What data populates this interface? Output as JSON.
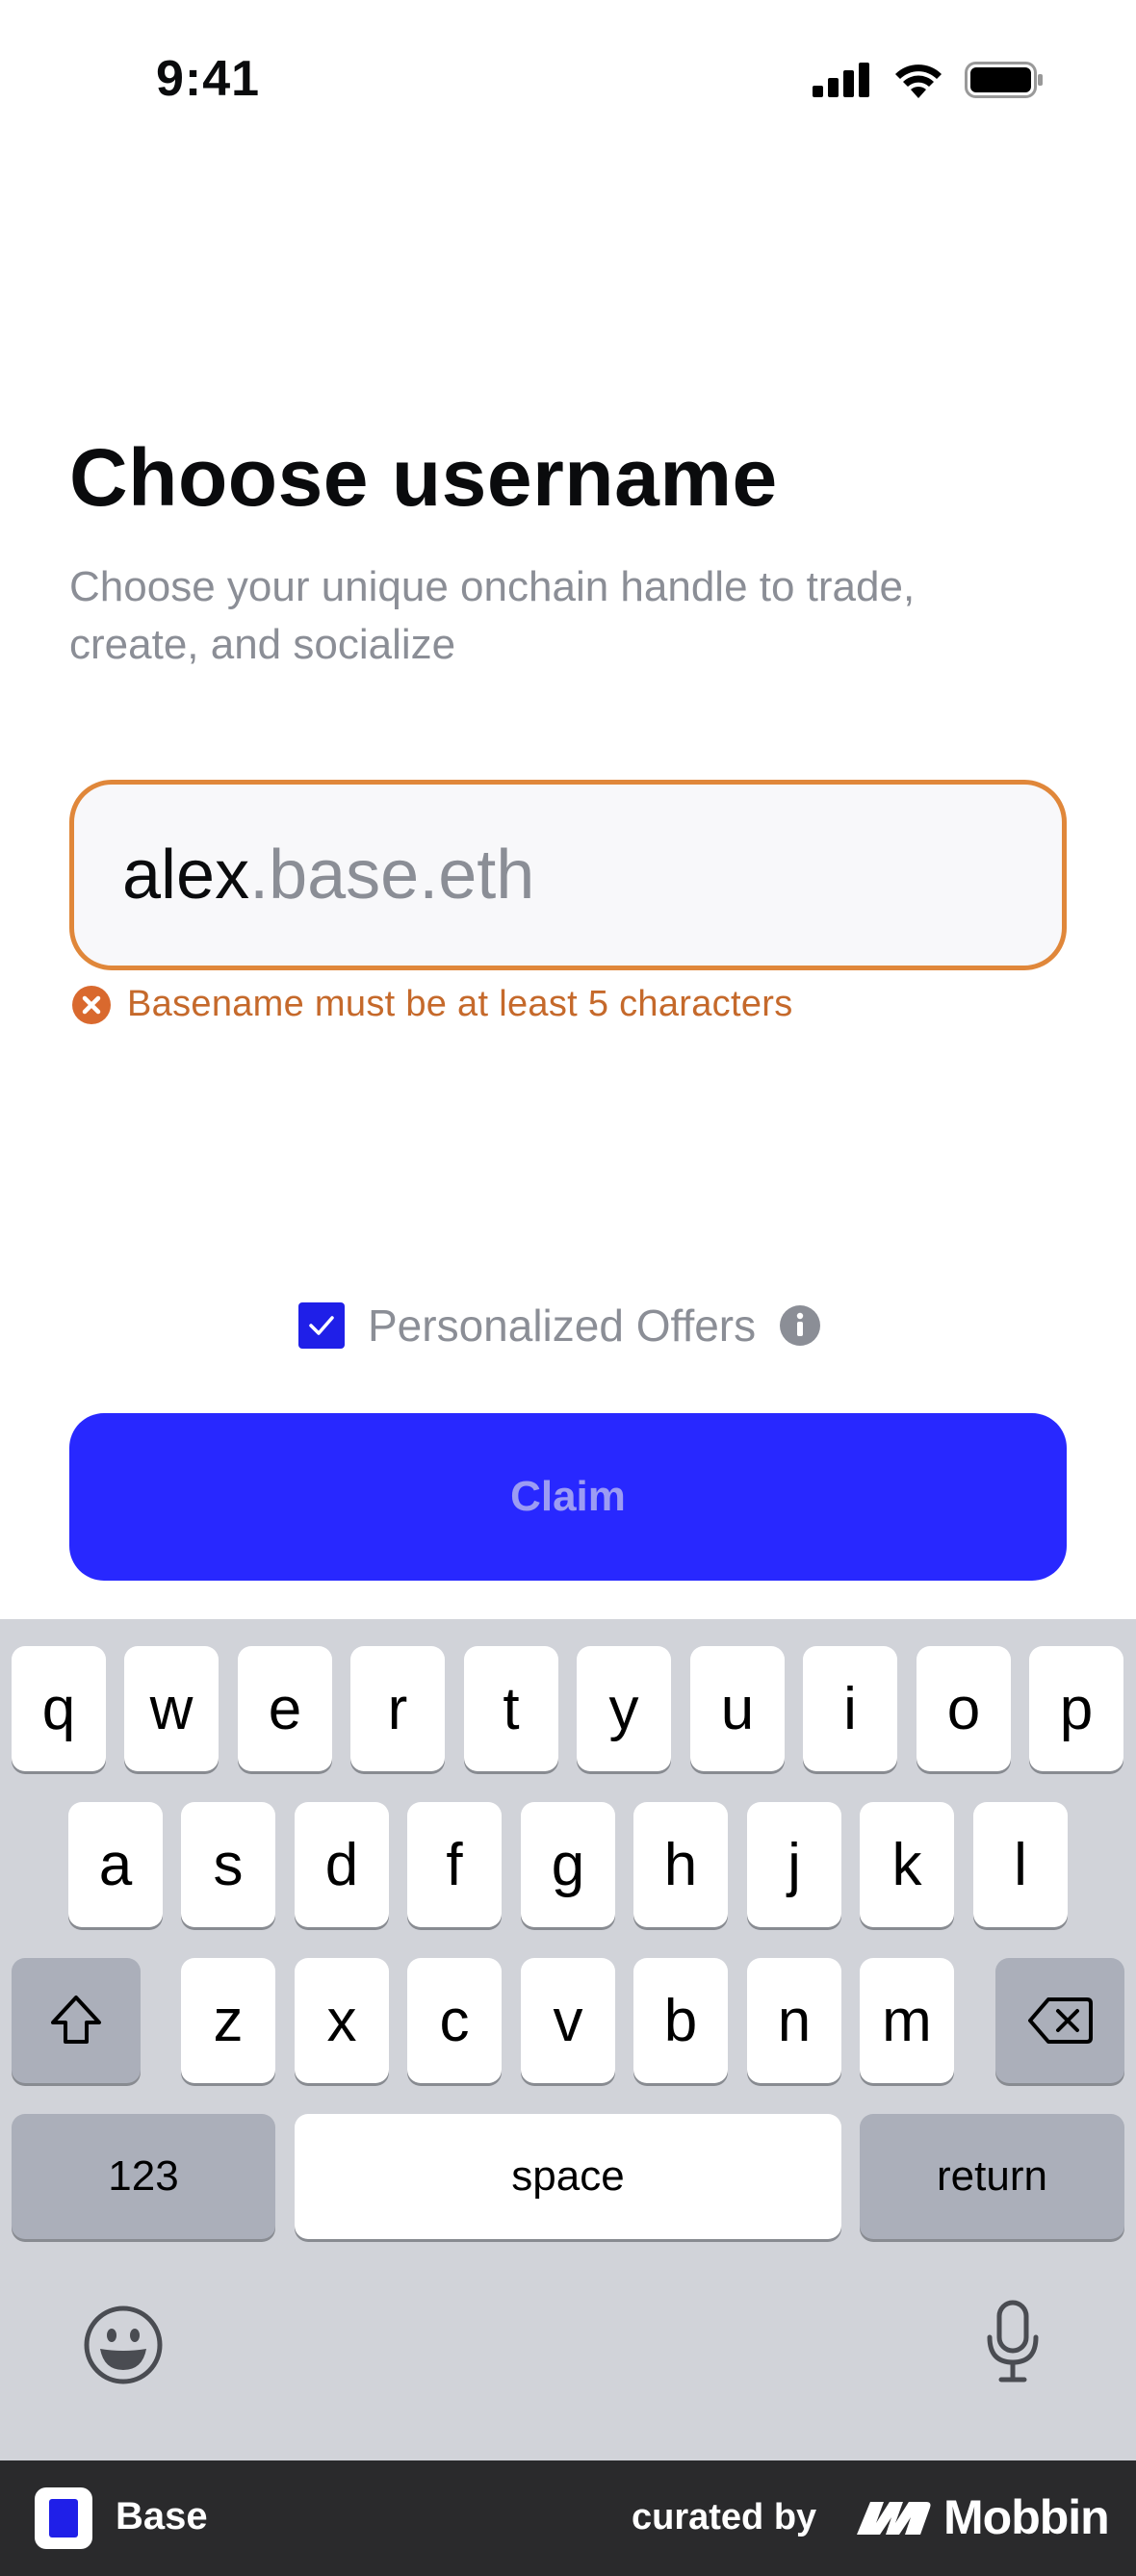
{
  "status_bar": {
    "time": "9:41",
    "icons": [
      "cellular-signal-icon",
      "wifi-icon",
      "battery-icon"
    ]
  },
  "header": {
    "title": "Choose username",
    "subtitle": "Choose your unique onchain handle to trade, create, and socialize"
  },
  "username_field": {
    "value": "alex",
    "suffix": ".base.eth",
    "border_color": "#e0873a"
  },
  "error": {
    "icon": "error-x-icon",
    "message": "Basename must be at least 5 characters",
    "color": "#c5692b"
  },
  "offers": {
    "checked": true,
    "label": "Personalized Offers",
    "info_icon": "info-icon"
  },
  "claim_button": {
    "label": "Claim",
    "color": "#2828ff"
  },
  "keyboard": {
    "row1": [
      "q",
      "w",
      "e",
      "r",
      "t",
      "y",
      "u",
      "i",
      "o",
      "p"
    ],
    "row2": [
      "a",
      "s",
      "d",
      "f",
      "g",
      "h",
      "j",
      "k",
      "l"
    ],
    "row3": [
      "z",
      "x",
      "c",
      "v",
      "b",
      "n",
      "m"
    ],
    "numbers_label": "123",
    "space_label": "space",
    "return_label": "return",
    "icons": [
      "shift-icon",
      "backspace-icon",
      "emoji-icon",
      "microphone-icon"
    ]
  },
  "banner": {
    "app_name": "Base",
    "curated_by": "curated by",
    "brand": "Mobbin"
  }
}
